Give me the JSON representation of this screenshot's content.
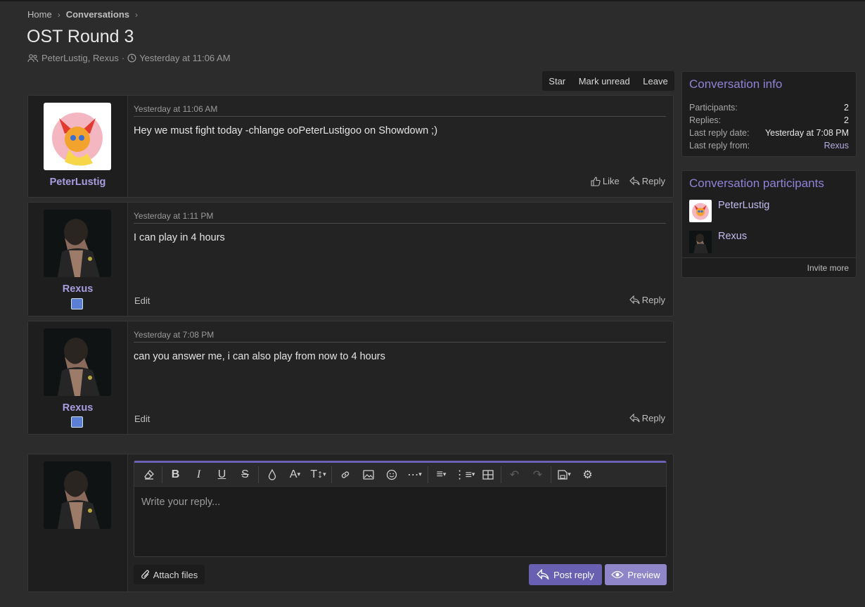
{
  "breadcrumb": {
    "home": "Home",
    "conversations": "Conversations"
  },
  "title": "OST Round 3",
  "meta": {
    "participants": "PeterLustig, Rexus",
    "separator": "·",
    "date": "Yesterday at 11:06 AM"
  },
  "actions": {
    "star": "Star",
    "mark_unread": "Mark unread",
    "leave": "Leave"
  },
  "messages": [
    {
      "user": "PeterLustig",
      "date": "Yesterday at 11:06 AM",
      "text": "Hey we must fight today -chlange ooPeterLustigoo on Showdown ;)",
      "like": "Like",
      "reply": "Reply"
    },
    {
      "user": "Rexus",
      "date": "Yesterday at 1:11 PM",
      "text": "I can play in 4 hours",
      "edit": "Edit",
      "reply": "Reply"
    },
    {
      "user": "Rexus",
      "date": "Yesterday at 7:08 PM",
      "text": "can you answer me, i can also play from now to 4 hours",
      "edit": "Edit",
      "reply": "Reply"
    }
  ],
  "info": {
    "title": "Conversation info",
    "participants_label": "Participants:",
    "participants_value": "2",
    "replies_label": "Replies:",
    "replies_value": "2",
    "last_date_label": "Last reply date:",
    "last_date_value": "Yesterday at 7:08 PM",
    "last_from_label": "Last reply from:",
    "last_from_value": "Rexus"
  },
  "participants_panel": {
    "title": "Conversation participants",
    "users": [
      "PeterLustig",
      "Rexus"
    ],
    "invite": "Invite more"
  },
  "reply": {
    "placeholder": "Write your reply...",
    "attach": "Attach files",
    "post": "Post reply",
    "preview": "Preview"
  },
  "colors": {
    "accent": "#6a60b2",
    "link": "#a99ce0",
    "background": "#2c2c2c"
  }
}
